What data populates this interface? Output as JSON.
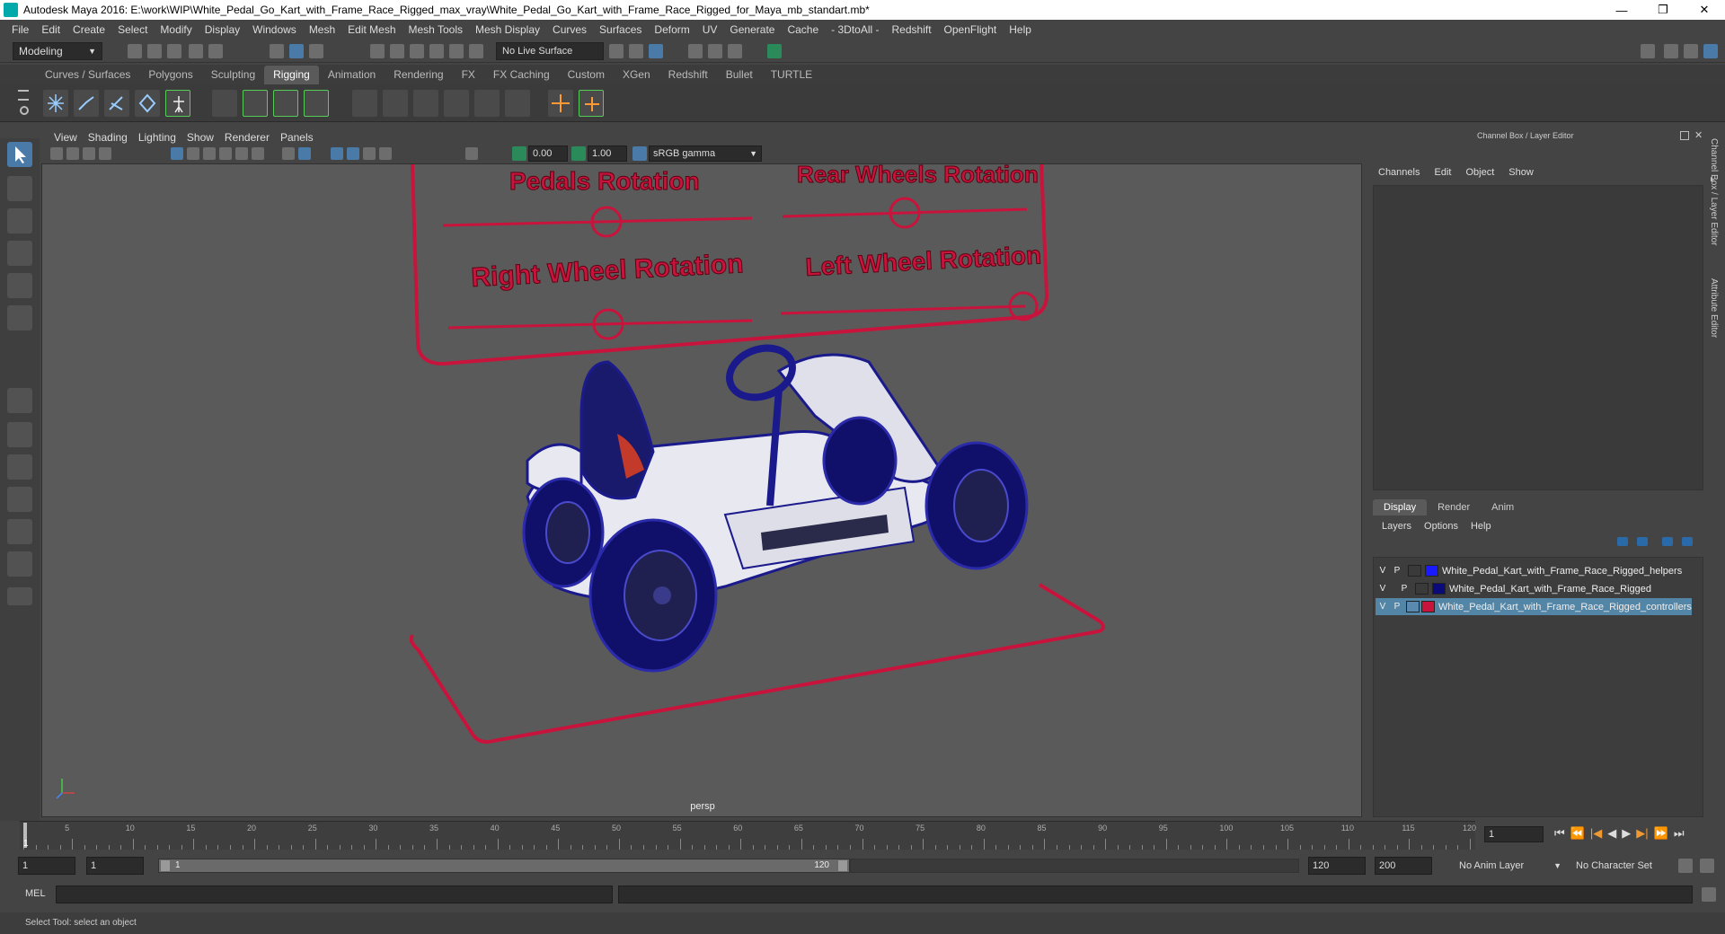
{
  "window": {
    "title": "Autodesk Maya 2016: E:\\work\\WIP\\White_Pedal_Go_Kart_with_Frame_Race_Rigged_max_vray\\White_Pedal_Go_Kart_with_Frame_Race_Rigged_for_Maya_mb_standart.mb*",
    "controls": [
      "—",
      "❐",
      "✕"
    ]
  },
  "menubar": [
    "File",
    "Edit",
    "Create",
    "Select",
    "Modify",
    "Display",
    "Windows",
    "Mesh",
    "Edit Mesh",
    "Mesh Tools",
    "Mesh Display",
    "Curves",
    "Surfaces",
    "Deform",
    "UV",
    "Generate",
    "Cache",
    "- 3DtoAll -",
    "Redshift",
    "OpenFlight",
    "Help"
  ],
  "statusline": {
    "mode": "Modeling",
    "live_surface": "No Live Surface"
  },
  "shelf_tabs": [
    "Curves / Surfaces",
    "Polygons",
    "Sculpting",
    "Rigging",
    "Animation",
    "Rendering",
    "FX",
    "FX Caching",
    "Custom",
    "XGen",
    "Redshift",
    "Bullet",
    "TURTLE"
  ],
  "active_shelf_tab": "Rigging",
  "panel_menu": [
    "View",
    "Shading",
    "Lighting",
    "Show",
    "Renderer",
    "Panels"
  ],
  "panel_toolbar": {
    "exposure": "0.00",
    "gamma": "1.00",
    "color_space": "sRGB gamma"
  },
  "viewport": {
    "camera_label": "persp",
    "controller_labels": [
      "Pedals Rotation",
      "Rear Wheels Rotation",
      "Right Wheel Rotation",
      "Left Wheel Rotation"
    ],
    "colors": {
      "controller": "#c8143c",
      "wire": "#1a1a8c",
      "background": "#5a5a5a"
    }
  },
  "channel_box": {
    "header": "Channel Box / Layer Editor",
    "menu": [
      "Channels",
      "Edit",
      "Object",
      "Show"
    ],
    "layer_tabs": [
      "Display",
      "Render",
      "Anim"
    ],
    "active_layer_tab": "Display",
    "layer_menu": [
      "Layers",
      "Options",
      "Help"
    ],
    "layers": [
      {
        "v": "V",
        "p": "P",
        "color": "#1a1aff",
        "name": "White_Pedal_Kart_with_Frame_Race_Rigged_helpers",
        "selected": false
      },
      {
        "v": "V",
        "p": "P",
        "color": "#0a0a7a",
        "name": "White_Pedal_Kart_with_Frame_Race_Rigged",
        "selected": false
      },
      {
        "v": "V",
        "p": "P",
        "color": "#c8143c",
        "name": "White_Pedal_Kart_with_Frame_Race_Rigged_controllers",
        "selected": true
      }
    ],
    "side_tabs": [
      "Channel Box / Layer Editor",
      "Attribute Editor"
    ]
  },
  "timeline": {
    "ticks": [
      "5",
      "10",
      "15",
      "20",
      "25",
      "30",
      "35",
      "40",
      "45",
      "50",
      "55",
      "60",
      "65",
      "70",
      "75",
      "80",
      "85",
      "90",
      "95",
      "100",
      "105",
      "110",
      "115",
      "120"
    ],
    "start_frame_label": "1",
    "current_frame": "1",
    "playback_controls": [
      "⏮",
      "⏭",
      "|◀",
      "◀",
      "▶",
      "▶|",
      "⏭",
      "⏭"
    ]
  },
  "range": {
    "start": "1",
    "playback_start": "1",
    "slider_start": "1",
    "slider_end": "120",
    "playback_end": "120",
    "end": "200",
    "anim_layer": "No Anim Layer",
    "character_set": "No Character Set"
  },
  "command_line": {
    "label": "MEL",
    "value": ""
  },
  "help_line": "Select Tool: select an object"
}
